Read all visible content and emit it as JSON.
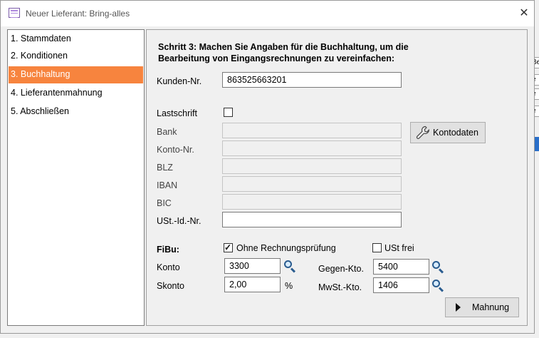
{
  "window": {
    "title": "Neuer Lieferant: Bring-alles",
    "close_label": "✕"
  },
  "nav": {
    "items": [
      {
        "label": "1. Stammdaten"
      },
      {
        "label": "2. Konditionen"
      },
      {
        "label": "3. Buchhaltung"
      },
      {
        "label": "4. Lieferantenmahnung"
      },
      {
        "label": "5. Abschließen"
      }
    ],
    "active_index": 2
  },
  "panel": {
    "heading": "Schritt 3: Machen Sie Angaben für die Buchhaltung, um die Bearbeitung von Eingangsrechnungen zu vereinfachen:",
    "kunden_nr": {
      "label": "Kunden-Nr.",
      "value": "863525663201"
    },
    "lastschrift": {
      "label": "Lastschrift",
      "checked": false
    },
    "bank": {
      "label": "Bank",
      "value": ""
    },
    "konto_nr": {
      "label": "Konto-Nr.",
      "value": ""
    },
    "blz": {
      "label": "BLZ",
      "value": ""
    },
    "iban": {
      "label": "IBAN",
      "value": ""
    },
    "bic": {
      "label": "BIC",
      "value": ""
    },
    "ust_id": {
      "label": "USt.-Id.-Nr.",
      "value": ""
    },
    "kontodaten_button": "Kontodaten",
    "fibu": {
      "label": "FiBu:",
      "ohne_rechnungspruefung": {
        "label": "Ohne Rechnungsprüfung",
        "checked": true
      },
      "ust_frei": {
        "label": "USt frei",
        "checked": false
      },
      "konto": {
        "label": "Konto",
        "value": "3300"
      },
      "skonto": {
        "label": "Skonto",
        "value": "2,00",
        "unit": "%"
      },
      "gegen_kto": {
        "label": "Gegen-Kto.",
        "value": "5400"
      },
      "mwst_kto": {
        "label": "MwSt.-Kto.",
        "value": "1406"
      }
    },
    "mahnung_button": "Mahnung"
  },
  "background": {
    "tab_fragments": [
      "Be",
      "e",
      "e",
      "e"
    ]
  }
}
